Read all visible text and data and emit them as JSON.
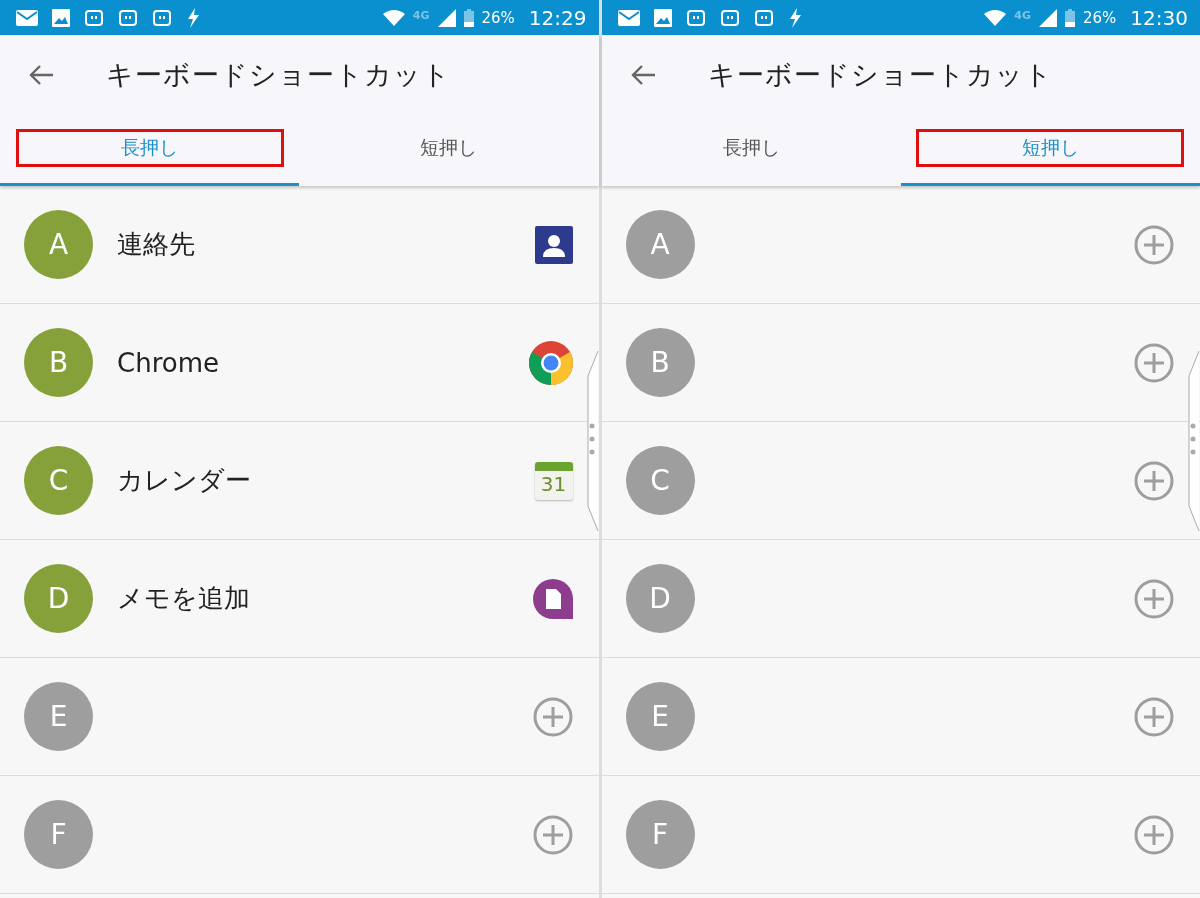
{
  "screens": [
    {
      "status_bar": {
        "network": "4G",
        "battery": "26%",
        "time": "12:29"
      },
      "title": "キーボードショートカット",
      "tabs": [
        {
          "label": "長押し",
          "selected": true,
          "highlighted": true
        },
        {
          "label": "短押し",
          "selected": false,
          "highlighted": false
        }
      ],
      "rows": [
        {
          "letter": "A",
          "assigned": true,
          "label": "連絡先",
          "kind": "contacts"
        },
        {
          "letter": "B",
          "assigned": true,
          "label": "Chrome",
          "kind": "chrome"
        },
        {
          "letter": "C",
          "assigned": true,
          "label": "カレンダー",
          "kind": "calendar",
          "icon_text": "31"
        },
        {
          "letter": "D",
          "assigned": true,
          "label": "メモを追加",
          "kind": "memo"
        },
        {
          "letter": "E",
          "assigned": false,
          "kind": "empty"
        },
        {
          "letter": "F",
          "assigned": false,
          "kind": "empty"
        }
      ]
    },
    {
      "status_bar": {
        "network": "4G",
        "battery": "26%",
        "time": "12:30"
      },
      "title": "キーボードショートカット",
      "tabs": [
        {
          "label": "長押し",
          "selected": false,
          "highlighted": false
        },
        {
          "label": "短押し",
          "selected": true,
          "highlighted": true
        }
      ],
      "rows": [
        {
          "letter": "A",
          "assigned": false,
          "kind": "empty"
        },
        {
          "letter": "B",
          "assigned": false,
          "kind": "empty"
        },
        {
          "letter": "C",
          "assigned": false,
          "kind": "empty"
        },
        {
          "letter": "D",
          "assigned": false,
          "kind": "empty"
        },
        {
          "letter": "E",
          "assigned": false,
          "kind": "empty"
        },
        {
          "letter": "F",
          "assigned": false,
          "kind": "empty"
        }
      ]
    }
  ]
}
